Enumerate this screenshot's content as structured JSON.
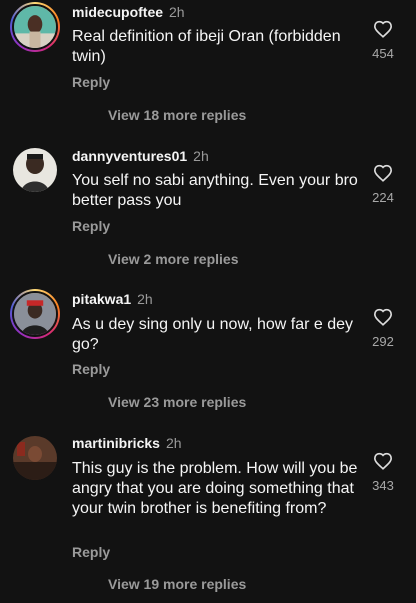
{
  "comments": [
    {
      "username": "midecupoftee",
      "time": "2h",
      "text": "Real definition of ibeji Oran (forbidden twin)",
      "reply_label": "Reply",
      "likes": "454",
      "view_more": "View 18 more replies",
      "has_story_ring": true
    },
    {
      "username": "dannyventures01",
      "time": "2h",
      "text": "You self no sabi anything. Even your bro better pass you",
      "reply_label": "Reply",
      "likes": "224",
      "view_more": "View 2 more replies",
      "has_story_ring": false
    },
    {
      "username": "pitakwa1",
      "time": "2h",
      "text": "As u dey sing only u now, how far e dey go?",
      "reply_label": "Reply",
      "likes": "292",
      "view_more": "View 23 more replies",
      "has_story_ring": true
    },
    {
      "username": "martinibricks",
      "time": "2h",
      "text": "This guy is the problem. How will you be angry that you are doing something that your twin brother is benefiting from?",
      "reply_label": "Reply",
      "likes": "343",
      "view_more": "View 19 more replies",
      "has_story_ring": false
    }
  ],
  "colors": {
    "background": "#121212",
    "text_primary": "#f5f5f5",
    "text_secondary": "#9a9a9a"
  },
  "icons": {
    "like": "heart-outline-icon"
  }
}
